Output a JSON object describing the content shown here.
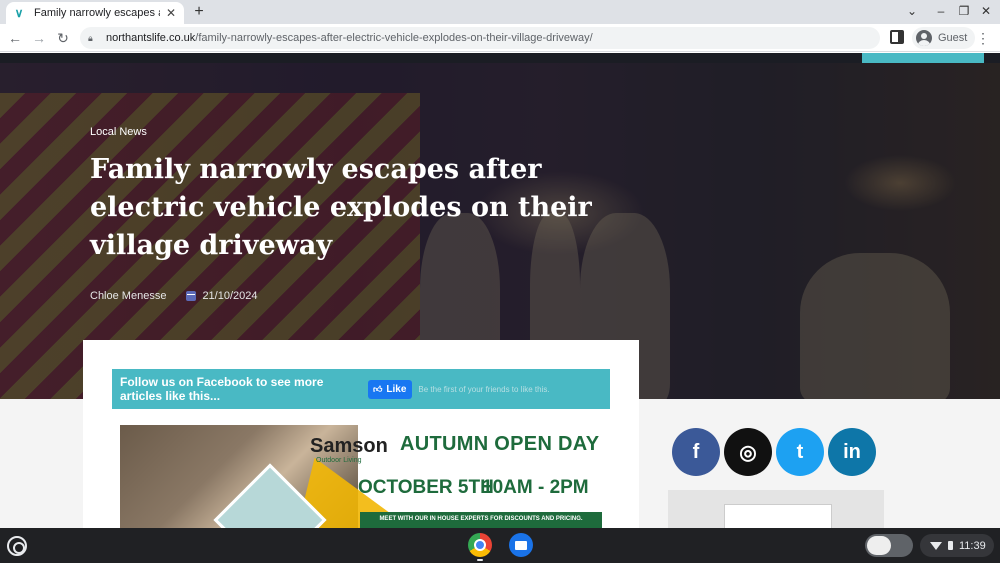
{
  "browser": {
    "tab_title": "Family narrowly escapes after electric vehicle explodes on their village driveway",
    "tab_favicon": "northants-life-icon",
    "new_tab_label": "+",
    "url_host": "northantslife.co.uk",
    "url_path": "/family-narrowly-escapes-after-electric-vehicle-explodes-on-their-village-driveway/",
    "profile_label": "Guest"
  },
  "article": {
    "category": "Local News",
    "title": "Family narrowly escapes after electric vehicle explodes on their village driveway",
    "author": "Chloe Menesse",
    "date": "21/10/2024"
  },
  "facebook": {
    "banner_text": "Follow us on Facebook to see more articles like this...",
    "like_label": "Like",
    "like_hint": "Be the first of your friends to like this."
  },
  "advert": {
    "brand": "Samson",
    "brand_sub": "Outdoor Living",
    "headline": "AUTUMN OPEN DAY",
    "date": "OCTOBER 5TH",
    "time": "10AM - 2PM",
    "strip_text": "MEET WITH OUR IN HOUSE EXPERTS FOR DISCOUNTS AND PRICING."
  },
  "social": {
    "facebook": "f",
    "instagram": "◎",
    "twitter": "t",
    "linkedin": "in"
  },
  "shelf": {
    "time": "11:39"
  },
  "colors": {
    "accent": "#49b9c4",
    "nav_dark": "#1b1d24",
    "facebook_blue": "#3b5998"
  }
}
